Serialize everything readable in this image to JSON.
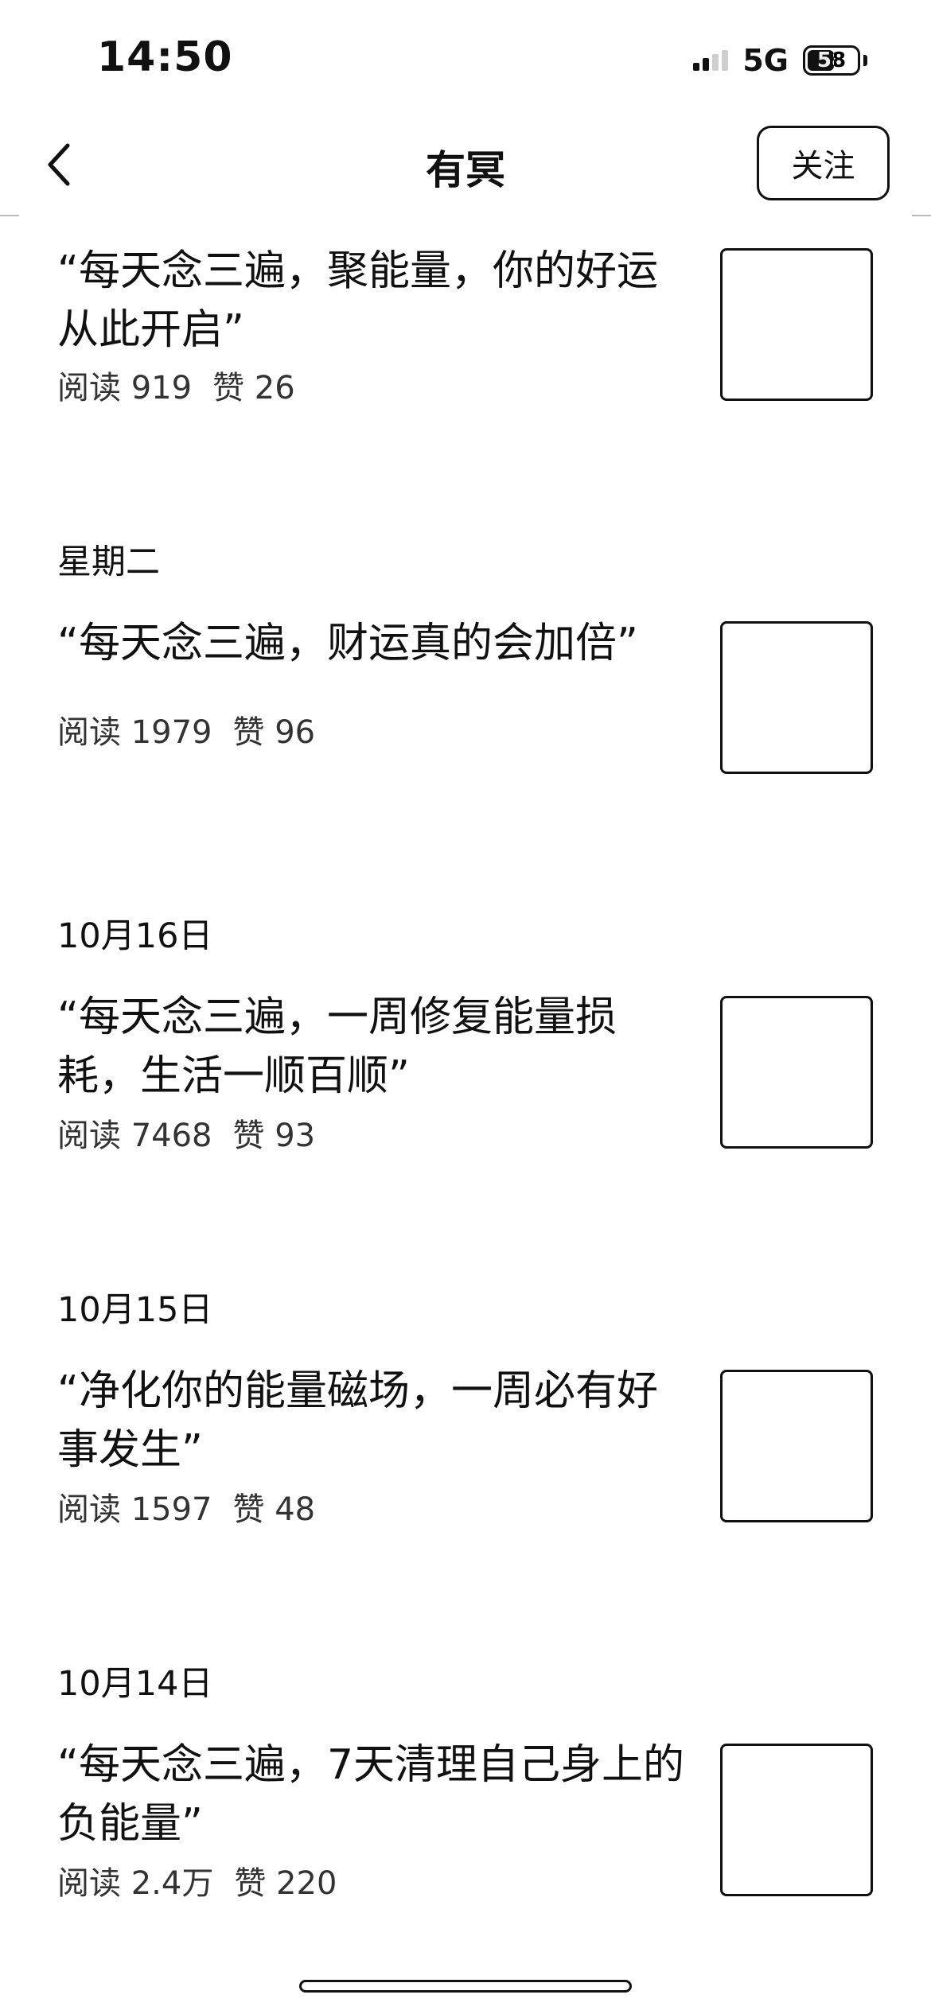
{
  "status_bar": {
    "time": "14:50",
    "network": "5G",
    "battery": "58"
  },
  "nav": {
    "title": "有冥",
    "follow_label": "关注"
  },
  "feed": [
    {
      "date": "",
      "title": "“每天念三遍，聚能量，你的好运从此开启”",
      "reads": "阅读 919",
      "likes": "赞 26"
    },
    {
      "date": "星期二",
      "title": "“每天念三遍，财运真的会加倍”",
      "reads": "阅读 1979",
      "likes": "赞 96"
    },
    {
      "date": "10月16日",
      "title": "“每天念三遍，一周修复能量损耗，生活一顺百顺”",
      "reads": "阅读 7468",
      "likes": "赞 93"
    },
    {
      "date": "10月15日",
      "title": "“净化你的能量磁场，一周必有好事发生”",
      "reads": "阅读 1597",
      "likes": "赞 48"
    },
    {
      "date": "10月14日",
      "title": "“每天念三遍，7天清理自己身上的负能量”",
      "reads": "阅读 2.4万",
      "likes": "赞 220"
    }
  ]
}
